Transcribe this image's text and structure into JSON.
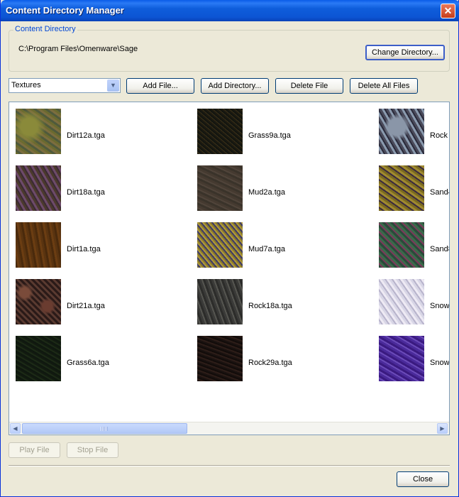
{
  "window": {
    "title": "Content Directory Manager"
  },
  "content_directory": {
    "label": "Content Directory",
    "path": "C:\\Program Files\\Omenware\\Sage",
    "change_button": "Change Directory..."
  },
  "toolbar": {
    "category": "Textures",
    "add_file": "Add File...",
    "add_directory": "Add Directory...",
    "delete_file": "Delete File",
    "delete_all": "Delete All Files"
  },
  "files": [
    {
      "name": "Dirt12a.tga",
      "texture": "dirt-olive"
    },
    {
      "name": "Dirt18a.tga",
      "texture": "dirt-cracked"
    },
    {
      "name": "Dirt1a.tga",
      "texture": "dirt-brown"
    },
    {
      "name": "Dirt21a.tga",
      "texture": "dirt-cobble"
    },
    {
      "name": "Grass6a.tga",
      "texture": "grass-dark"
    },
    {
      "name": "Grass9a.tga",
      "texture": "grass-speckled"
    },
    {
      "name": "Mud2a.tga",
      "texture": "mud-brown"
    },
    {
      "name": "Mud7a.tga",
      "texture": "mud-noisy"
    },
    {
      "name": "Rock18a.tga",
      "texture": "rock-grey"
    },
    {
      "name": "Rock29a.tga",
      "texture": "rock-dark"
    },
    {
      "name": "Rock",
      "texture": "rock-blue"
    },
    {
      "name": "Sand4",
      "texture": "sand-gold"
    },
    {
      "name": "Sand8",
      "texture": "sand-green"
    },
    {
      "name": "Snow",
      "texture": "snow-white"
    },
    {
      "name": "Snow",
      "texture": "snow-purple"
    }
  ],
  "footer": {
    "play_file": "Play File",
    "stop_file": "Stop File",
    "close": "Close"
  },
  "icons": {
    "close_window": "close-icon",
    "dropdown": "chevron-down-icon",
    "scroll_left": "arrow-left-icon",
    "scroll_right": "arrow-right-icon"
  },
  "colors": {
    "title_bar": "#0c55d4",
    "close_button": "#c73d1a",
    "group_label": "#0046d5"
  }
}
